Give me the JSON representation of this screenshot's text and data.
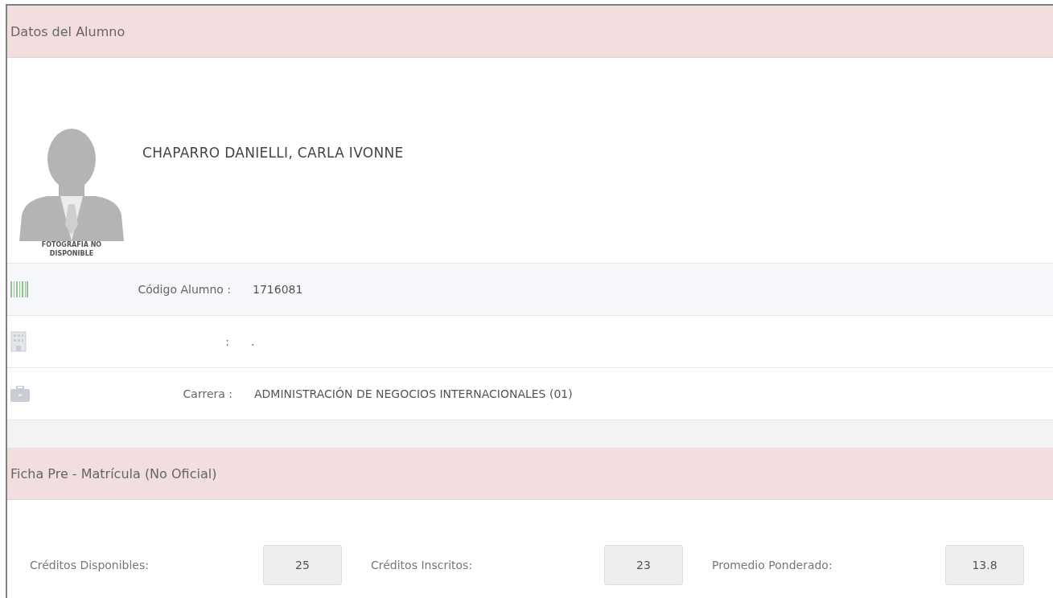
{
  "student_panel": {
    "title": "Datos del Alumno",
    "photo_caption": "FOTOGRAFIA NO DISPONIBLE",
    "name": "CHAPARRO DANIELLI, CARLA IVONNE",
    "rows": [
      {
        "kind": "barcode",
        "label": "Código Alumno :",
        "value": "1716081"
      },
      {
        "kind": "building",
        "label": ":",
        "value": "."
      },
      {
        "kind": "briefcase",
        "label": "Carrera :",
        "value": "ADMINISTRACIÓN DE NEGOCIOS INTERNACIONALES (01)"
      }
    ]
  },
  "enrollment_panel": {
    "title": "Ficha Pre - Matrícula (No Oficial)",
    "fields": [
      {
        "label": "Créditos Disponibles:",
        "value": "25"
      },
      {
        "label": "Créditos Inscritos:",
        "value": "23"
      },
      {
        "label": "Promedio Ponderado:",
        "value": "13.8"
      }
    ]
  }
}
